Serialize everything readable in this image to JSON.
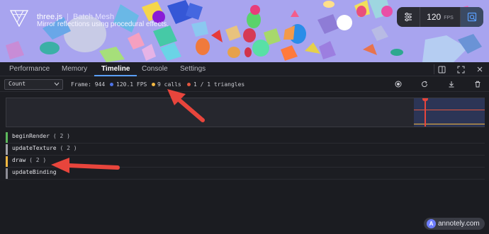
{
  "header": {
    "title": "three.js",
    "subtitle": "Batch Mesh",
    "description": "Mirror reflections using procedural effects."
  },
  "hud": {
    "fps_value": "120",
    "fps_unit": "FPS",
    "icons": [
      "settings-sliders-icon",
      "inspector-icon"
    ]
  },
  "tabs": [
    {
      "label": "Performance",
      "active": false
    },
    {
      "label": "Memory",
      "active": false
    },
    {
      "label": "Timeline",
      "active": true
    },
    {
      "label": "Console",
      "active": false
    },
    {
      "label": "Settings",
      "active": false
    }
  ],
  "tab_icons": [
    "dock-panel-icon",
    "fullscreen-icon",
    "close-icon"
  ],
  "toolbar": {
    "select_value": "Count",
    "frame": "Frame: 944",
    "fps": "120.1 FPS",
    "calls": "9 calls",
    "triangles": "1 / 1 triangles",
    "icons": [
      "record-icon",
      "refresh-icon",
      "download-icon",
      "trash-icon"
    ]
  },
  "colors": {
    "accent": "#5aa0ff",
    "fps_dot": "#4e74e8",
    "calls_dot": "#f5b942",
    "triangles_dot": "#e2573f",
    "annotation_arrow": "#e8453c",
    "scene_background": "#a8a4ef"
  },
  "timeline": {
    "rows": [
      {
        "name": "beginRender",
        "count": "( 2 )",
        "color": "#5cb85c"
      },
      {
        "name": "updateTexture",
        "count": "( 2 )",
        "color": "#a3a3ab"
      },
      {
        "name": "draw",
        "count": "( 2 )",
        "color": "#f5b942"
      },
      {
        "name": "updateBinding",
        "count": "",
        "color": "#8d8d96"
      }
    ]
  },
  "watermark": {
    "icon_letter": "A",
    "text": "annotely.com"
  }
}
